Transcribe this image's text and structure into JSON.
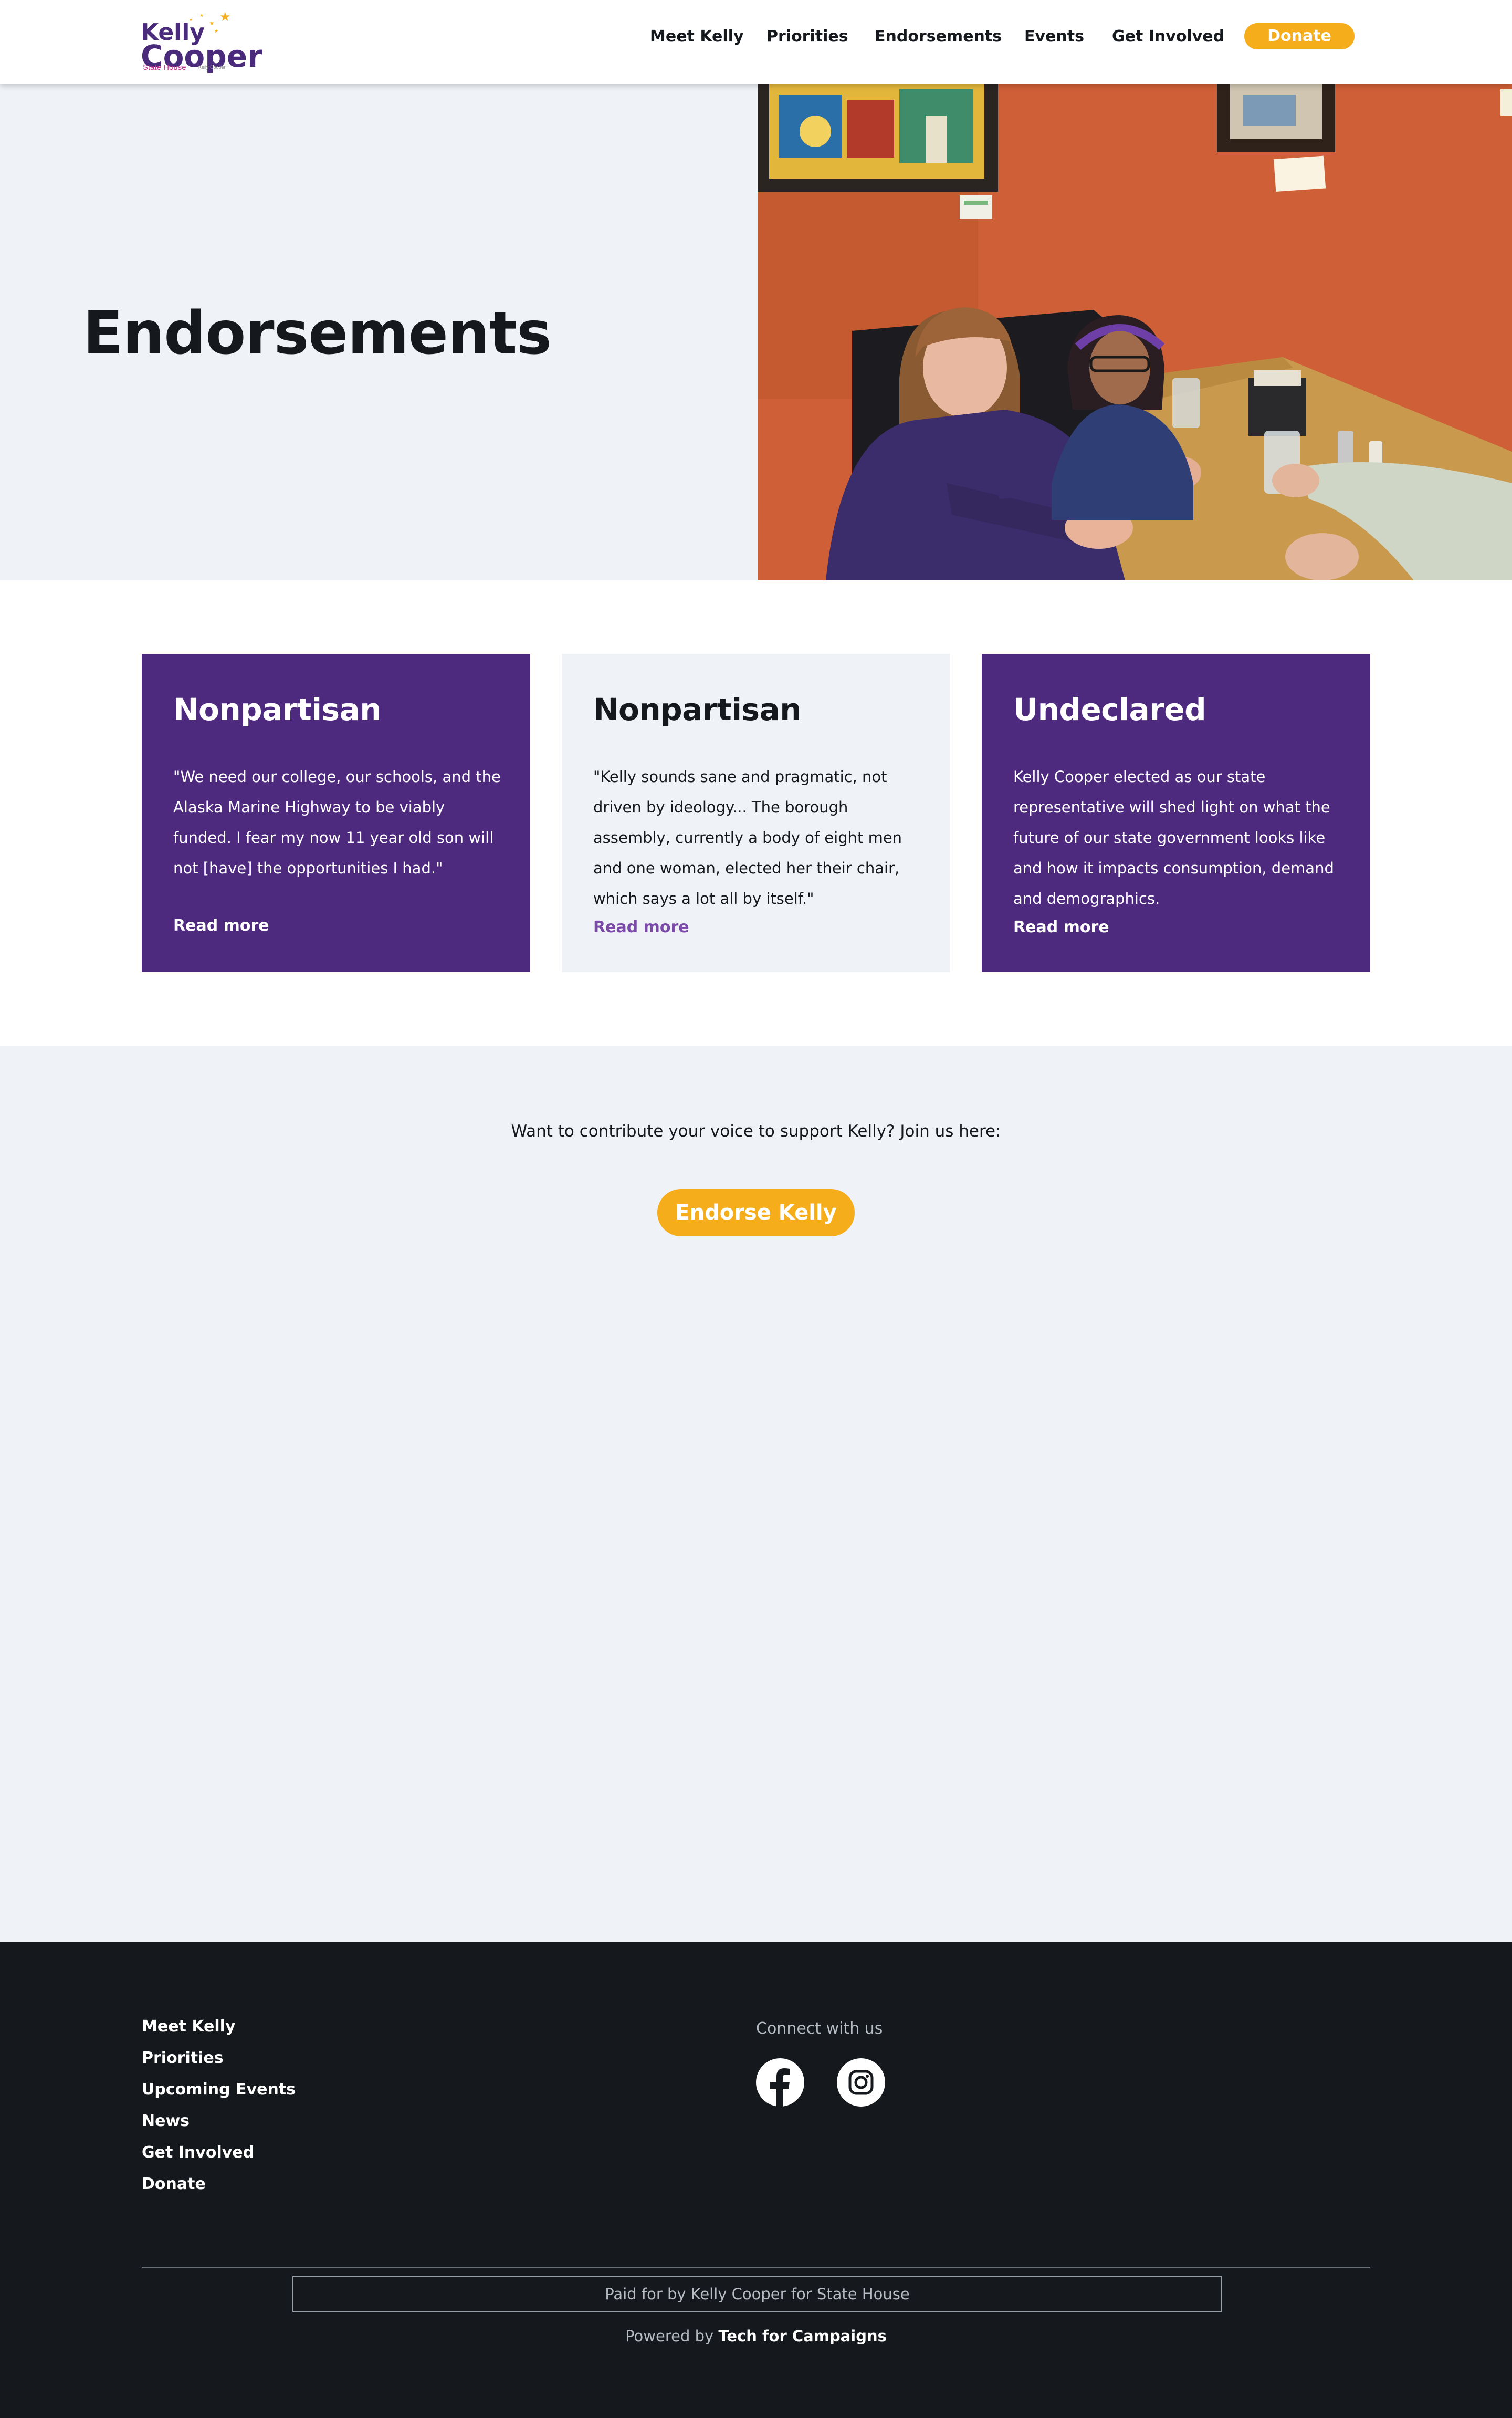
{
  "header": {
    "logo": {
      "first_name": "Kelly",
      "last_name": "Cooper",
      "subtitle": "State House",
      "tagline": "Kelly Cooper"
    },
    "nav": [
      {
        "label": "Meet Kelly"
      },
      {
        "label": "Priorities"
      },
      {
        "label": "Endorsements"
      },
      {
        "label": "Events"
      },
      {
        "label": "Get Involved"
      }
    ],
    "donate_label": "Donate"
  },
  "hero": {
    "title": "Endorsements"
  },
  "cards": [
    {
      "title": "Nonpartisan",
      "text": "\"We need our college, our schools, and the Alaska Marine Highway to be viably funded. I fear my now 11 year old son will not [have] the opportunities I had.\"",
      "link": "Read more"
    },
    {
      "title": "Nonpartisan",
      "text": "\"Kelly sounds sane and pragmatic, not driven by ideology... The borough assembly, currently a body of eight men and one woman, elected her their chair, which says a lot all by itself.\"",
      "link": "Read more"
    },
    {
      "title": "Undeclared",
      "text": "Kelly Cooper elected as our state representative will shed light on what the future of our state government looks like and how it impacts consumption, demand and demographics.",
      "link": "Read more"
    }
  ],
  "endorse": {
    "text": "Want to contribute your voice to support Kelly? Join us here:",
    "button_label": "Endorse Kelly"
  },
  "footer": {
    "links": [
      {
        "label": "Meet Kelly"
      },
      {
        "label": "Priorities"
      },
      {
        "label": "Upcoming Events"
      },
      {
        "label": "News"
      },
      {
        "label": "Get Involved"
      },
      {
        "label": "Donate"
      }
    ],
    "connect_label": "Connect with us",
    "social": [
      {
        "icon": "facebook-icon"
      },
      {
        "icon": "instagram-icon"
      }
    ],
    "paid_for": "Paid for by Kelly Cooper for State House",
    "powered_prefix": "Powered by",
    "powered_brand": "Tech for Campaigns"
  },
  "colors": {
    "brand_purple": "#4e2a7f",
    "accent_yellow": "#f6ad1b",
    "light_bg": "#eff2f6",
    "footer_bg": "#15181c"
  }
}
